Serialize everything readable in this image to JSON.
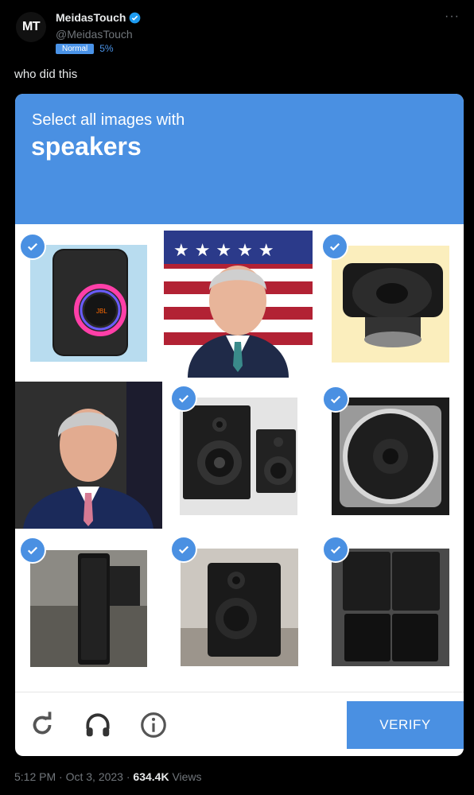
{
  "tweet": {
    "avatar_text": "MT",
    "name": "MeidasTouch",
    "handle": "@MeidasTouch",
    "badge": "Normal",
    "percent": "5%",
    "more": "···",
    "text": "who did this",
    "time": "5:12 PM · Oct 3, 2023 · ",
    "views_count": "634.4K",
    "views_label": " Views"
  },
  "captcha": {
    "instruction": "Select all images with",
    "target": "speakers",
    "verify_label": "VERIFY",
    "tiles": [
      {
        "subject": "party-speaker",
        "selected": true
      },
      {
        "subject": "politician-flag",
        "selected": false
      },
      {
        "subject": "speaker-driver",
        "selected": true
      },
      {
        "subject": "politician-portrait",
        "selected": false
      },
      {
        "subject": "bookshelf-speaker-pair",
        "selected": true
      },
      {
        "subject": "car-speaker",
        "selected": true
      },
      {
        "subject": "tower-speaker",
        "selected": true
      },
      {
        "subject": "studio-monitor",
        "selected": true
      },
      {
        "subject": "pa-speaker-stack",
        "selected": true
      }
    ]
  },
  "colors": {
    "accent": "#4a90e2",
    "background": "#000000",
    "muted": "#71767b"
  }
}
